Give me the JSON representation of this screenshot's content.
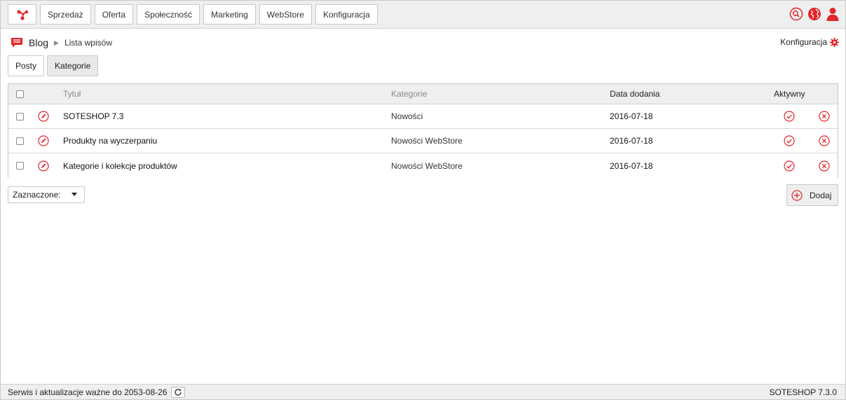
{
  "colors": {
    "accent": "#e2262b",
    "topbar_bg": "#efefef",
    "border": "#c8c8c8"
  },
  "nav": {
    "logo_icon": "soteshop-logo-icon",
    "items": [
      {
        "label": "Sprzedaż"
      },
      {
        "label": "Oferta"
      },
      {
        "label": "Społeczność"
      },
      {
        "label": "Marketing"
      },
      {
        "label": "WebStore"
      },
      {
        "label": "Konfiguracja"
      }
    ],
    "icons": [
      "search-icon",
      "globe-icon",
      "user-icon"
    ]
  },
  "breadcrumb": {
    "icon": "blog-icon",
    "root": "Blog",
    "current": "Lista wpisów"
  },
  "config_link": {
    "label": "Konfiguracja",
    "icon": "gear-icon"
  },
  "tabs": [
    {
      "label": "Posty",
      "active": true
    },
    {
      "label": "Kategorie",
      "active": false
    }
  ],
  "table": {
    "columns": {
      "title": "Tytuł",
      "categories": "Kategorie",
      "date": "Data dodania",
      "active": "Aktywny"
    },
    "rows": [
      {
        "title": "SOTESHOP 7.3",
        "category": "Nowości",
        "date": "2016-07-18",
        "active": true
      },
      {
        "title": "Produkty na wyczerpaniu",
        "category": "Nowości WebStore",
        "date": "2016-07-18",
        "active": true
      },
      {
        "title": "Kategorie i kolekcje produktów",
        "category": "Nowości WebStore",
        "date": "2016-07-18",
        "active": true
      }
    ]
  },
  "bulk_select": {
    "value": "Zaznaczone:"
  },
  "add_button": {
    "label": "Dodaj",
    "icon": "plus-circle-icon"
  },
  "footer": {
    "service_text": "Serwis i aktualizacje ważne do 2053-08-26",
    "refresh_icon": "refresh-icon",
    "version": "SOTESHOP 7.3.0"
  }
}
